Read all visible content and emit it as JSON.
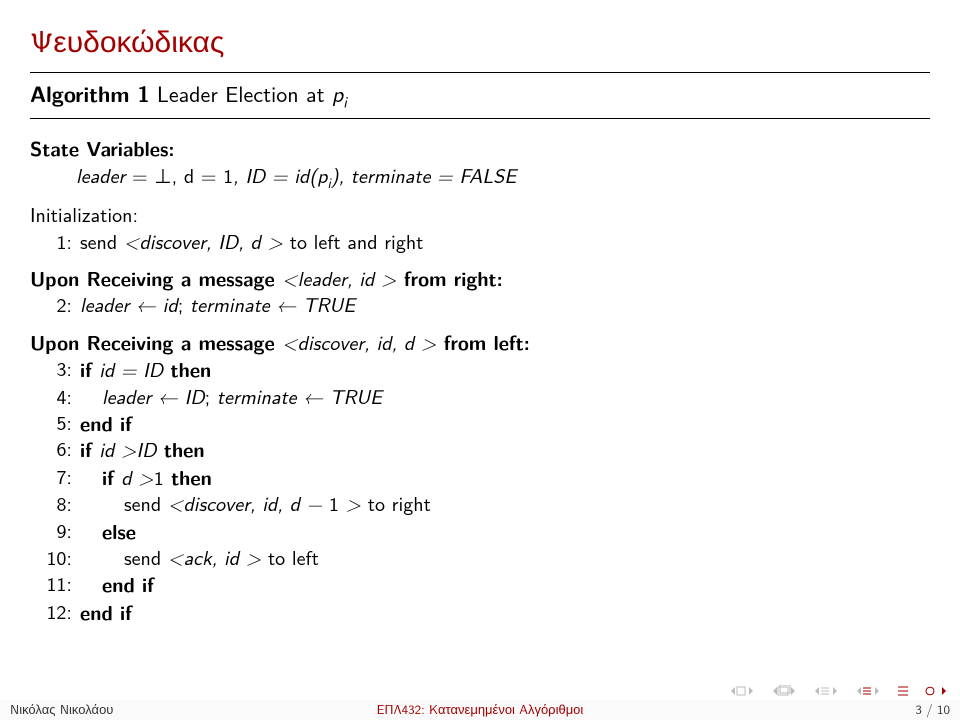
{
  "title": "Ψευδοκώδικας",
  "algo_label": "Algorithm 1",
  "algo_title_rest": " Leader Election at ",
  "algo_title_var": "p",
  "algo_title_sub": "i",
  "state_vars_label": "State Variables:",
  "state_vars_line_a": "leader",
  "state_vars_line_b": " = ⊥, d = ",
  "state_vars_line_c": "1",
  "state_vars_line_d": ", ID = id(p",
  "state_vars_line_e": "), terminate = FALSE",
  "init_label": "Initialization:",
  "ln1": "1:",
  "line1_a": "send ",
  "line1_b": "<discover, ID, d >",
  "line1_c": " to left and right",
  "recv_right_a": "Upon Receiving a message ",
  "recv_right_b": "<leader, id >",
  "recv_right_c": " from right:",
  "ln2": "2:",
  "line2_a": "leader ← id",
  "line2_b": "; ",
  "line2_c": "terminate ← TRUE",
  "recv_left_a": "Upon Receiving a message ",
  "recv_left_b": "<discover, id, d >",
  "recv_left_c": " from left:",
  "ln3": "3:",
  "line3_if": "if ",
  "line3_cond": "id = ID",
  "line3_then": " then",
  "ln4": "4:",
  "line4_a": "leader ← ID",
  "line4_b": "; ",
  "line4_c": "terminate ← TRUE",
  "ln5": "5:",
  "line5": "end if",
  "ln6": "6:",
  "line6_if": "if ",
  "line6_cond": "id >ID",
  "line6_then": " then",
  "ln7": "7:",
  "line7_if": "if ",
  "line7_cond": "d >",
  "line7_one": "1",
  "line7_then": " then",
  "ln8": "8:",
  "line8_a": "send ",
  "line8_b": "<discover, id, d − ",
  "line8_c": "1",
  "line8_d": " >",
  "line8_e": " to right",
  "ln9": "9:",
  "line9": "else",
  "ln10": "10:",
  "line10_a": "send ",
  "line10_b": "<ack, id >",
  "line10_c": " to left",
  "ln11": "11:",
  "line11": "end if",
  "ln12": "12:",
  "line12": "end if",
  "footer_left": "Νικόλας Νικολάου",
  "footer_center": "ΕΠΛ432: Κατανεμημένοι Αλγόριθμοι",
  "footer_right": "3 / 10",
  "chart_data": {
    "type": "table",
    "title": "Algorithm 1 Leader Election at p_i — pseudocode lines",
    "columns": [
      "line",
      "text"
    ],
    "rows": [
      [
        "State Variables:",
        "leader = ⊥, d = 1, ID = id(p_i), terminate = FALSE"
      ],
      [
        "Initialization:",
        ""
      ],
      [
        "1:",
        "send <discover, ID, d> to left and right"
      ],
      [
        "Upon Receiving a message <leader, id> from right:",
        ""
      ],
      [
        "2:",
        "leader ← id; terminate ← TRUE"
      ],
      [
        "Upon Receiving a message <discover, id, d> from left:",
        ""
      ],
      [
        "3:",
        "if id = ID then"
      ],
      [
        "4:",
        "  leader ← ID; terminate ← TRUE"
      ],
      [
        "5:",
        "end if"
      ],
      [
        "6:",
        "if id > ID then"
      ],
      [
        "7:",
        "  if d > 1 then"
      ],
      [
        "8:",
        "    send <discover, id, d − 1> to right"
      ],
      [
        "9:",
        "  else"
      ],
      [
        "10:",
        "    send <ack, id> to left"
      ],
      [
        "11:",
        "  end if"
      ],
      [
        "12:",
        "end if"
      ]
    ]
  }
}
